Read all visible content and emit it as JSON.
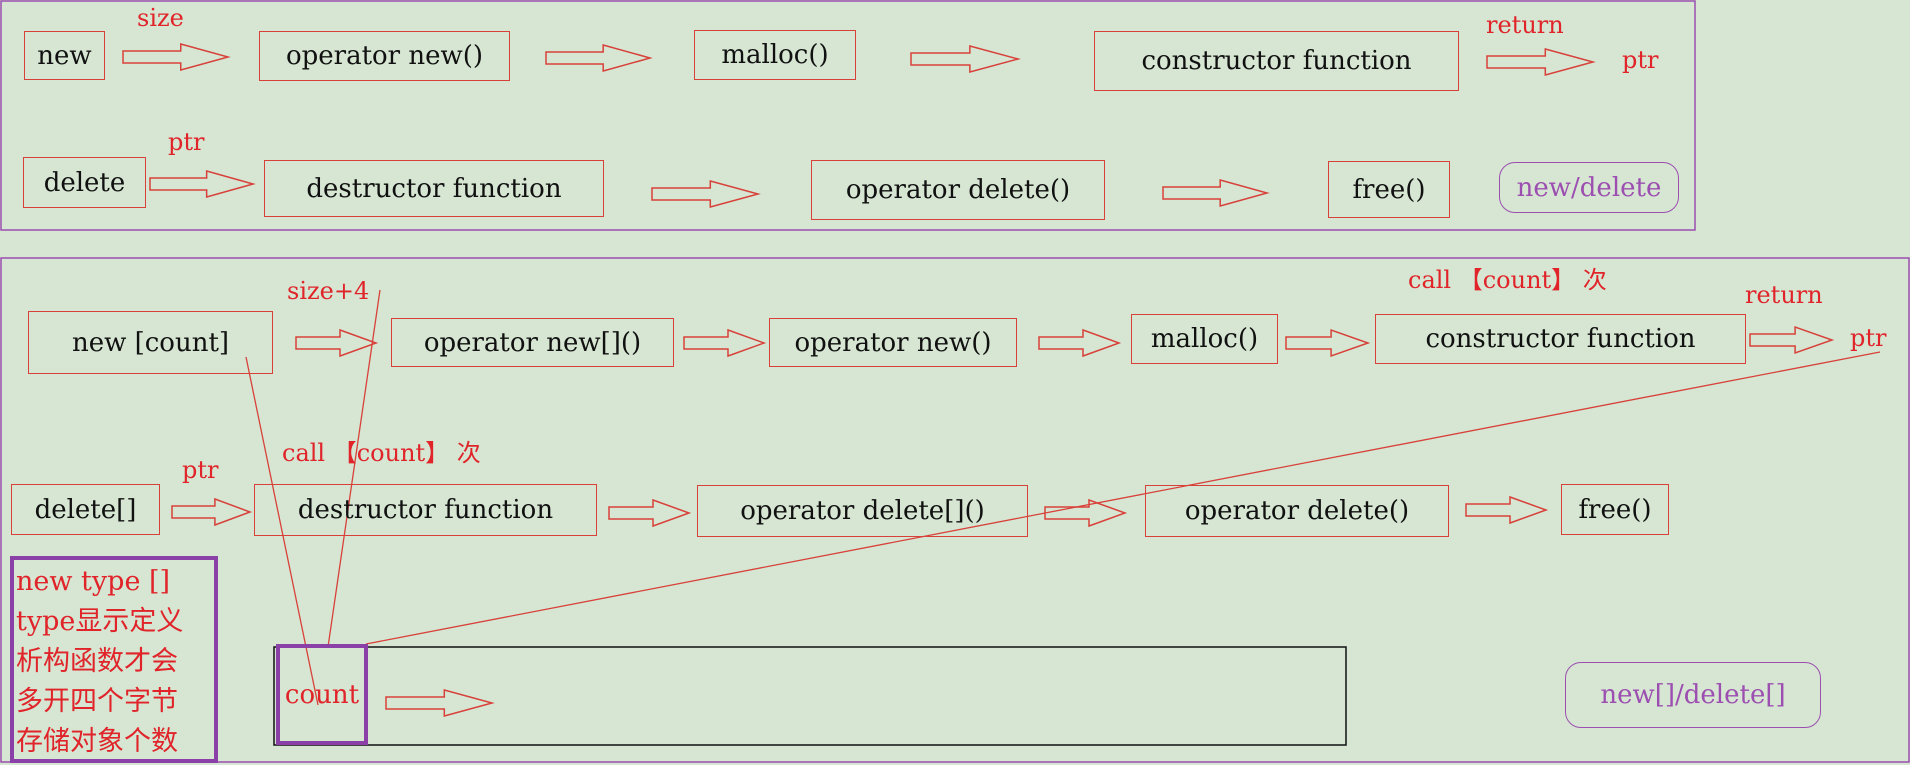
{
  "single": {
    "row1": {
      "new": "new",
      "size_label": "size",
      "op_new": "operator new()",
      "malloc": "malloc()",
      "ctor": "constructor function",
      "return_label": "return",
      "ptr": "ptr"
    },
    "row2": {
      "delete": "delete",
      "ptr_label": "ptr",
      "dtor": "destructor function",
      "op_delete": "operator delete()",
      "free": "free()"
    },
    "tag": "new/delete"
  },
  "array": {
    "row1": {
      "new_count": "new [count]",
      "size4_label": "size+4",
      "op_new_arr": "operator new[]()",
      "op_new": "operator new()",
      "malloc": "malloc()",
      "call_label": "call 【count】 次",
      "ctor": "constructor function",
      "return_label": "return",
      "ptr": "ptr"
    },
    "row2": {
      "delete_arr": "delete[]",
      "ptr_label": "ptr",
      "call_label": "call 【count】 次",
      "dtor": "destructor function",
      "op_delete_arr": "operator delete[]()",
      "op_delete": "operator delete()",
      "free": "free()"
    },
    "note_lines": [
      "new type []",
      "type显示定义",
      "析构函数才会",
      "多开四个字节",
      "存储对象个数"
    ],
    "count": "count",
    "tag": "new[]/delete[]"
  },
  "colors": {
    "background": "#d6e6d3",
    "red": "#d8413a",
    "purple": "#9c4fb0",
    "dark_purple": "#8b40a8"
  }
}
